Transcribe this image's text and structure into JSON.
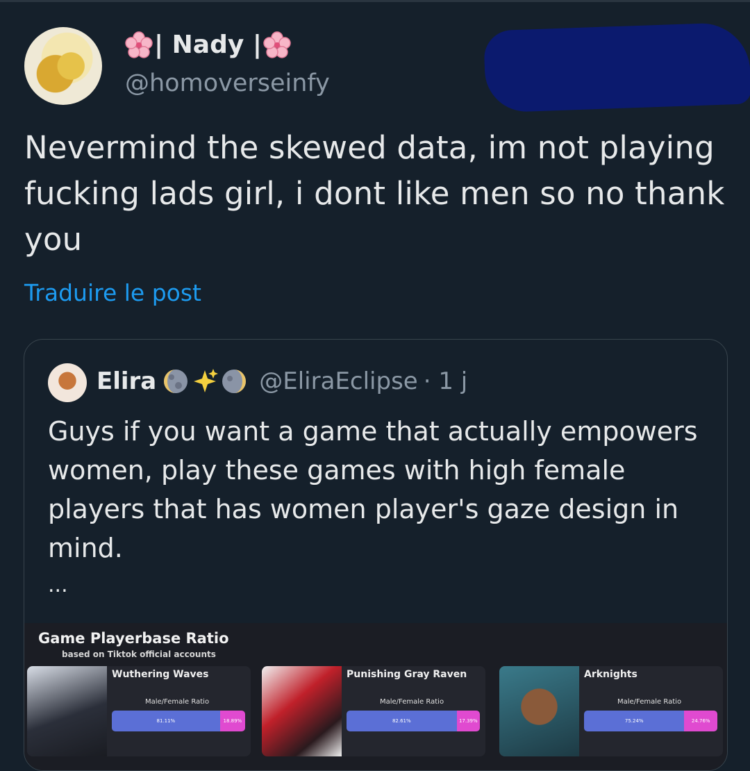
{
  "author": {
    "display_name": "| Nady |",
    "flower_icon": "cherry-blossom-icon",
    "handle": "@homoverseinfy"
  },
  "tweet": {
    "text": "Nevermind the skewed data, im not playing fucking lads girl, i dont like men so no thank you",
    "translate_label": "Traduire le post"
  },
  "quote": {
    "name": "Elira",
    "emojis": [
      "moon-icon",
      "sparkles-icon",
      "moon-icon"
    ],
    "handle": "@EliraEclipse",
    "time": "· 1 j",
    "text": "Guys if you want a game that actually empowers women, play these games with high female players that has women player's gaze design in mind.",
    "ellipsis": "...",
    "media": {
      "title": "Game Playerbase Ratio",
      "subtitle": "based on Tiktok official accounts",
      "games": [
        {
          "name": "Wuthering Waves",
          "ratio_label": "Male/Female Ratio",
          "male_label": "81.11%",
          "female_label": "18.89%",
          "male": 81.11
        },
        {
          "name": "Punishing Gray Raven",
          "ratio_label": "Male/Female Ratio",
          "male_label": "82.61%",
          "female_label": "17.39%",
          "male": 82.61
        },
        {
          "name": "Arknights",
          "ratio_label": "Male/Female Ratio",
          "male_label": "75.24%",
          "female_label": "24.76%",
          "male": 75.24
        }
      ]
    }
  },
  "colors": {
    "background": "#15202b",
    "link": "#1d9bf0",
    "male_bar": "#5b6fd6",
    "female_bar": "#e04ad0",
    "redaction": "#0b1a6e"
  }
}
